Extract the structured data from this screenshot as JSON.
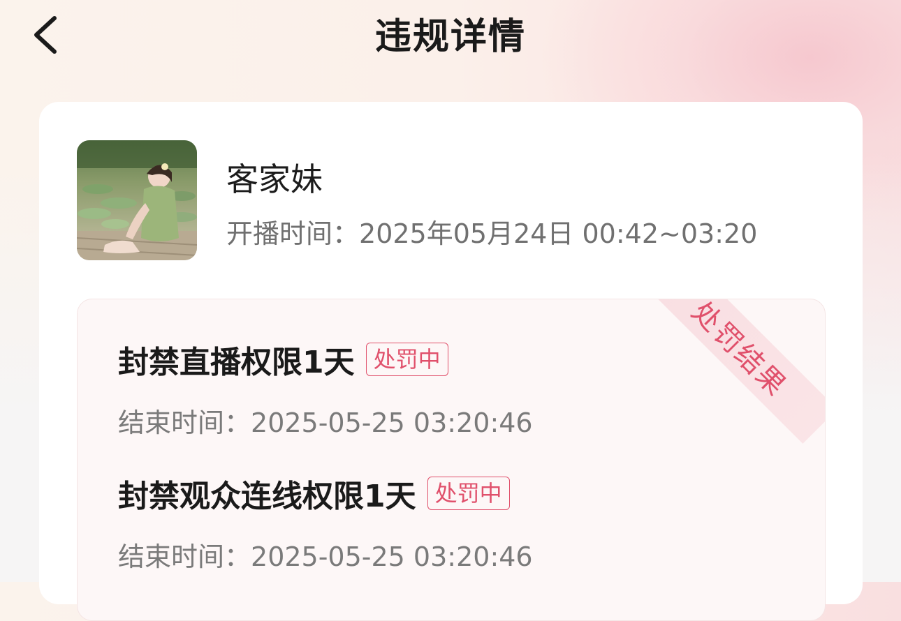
{
  "header": {
    "title": "违规详情",
    "back_icon": "chevron-left-icon"
  },
  "streamer": {
    "name": "客家妹",
    "live_time_label": "开播时间：",
    "live_time_value": "2025年05月24日 00:42~03:20"
  },
  "result": {
    "ribbon_label": "处罚结果",
    "penalties": [
      {
        "title": "封禁直播权限1天",
        "status": "处罚中",
        "end_label": "结束时间：",
        "end_value": "2025-05-25 03:20:46"
      },
      {
        "title": "封禁观众连线权限1天",
        "status": "处罚中",
        "end_label": "结束时间：",
        "end_value": "2025-05-25 03:20:46"
      }
    ]
  },
  "colors": {
    "accent": "#e0506b",
    "title_text": "#1a1a1a",
    "secondary_text": "#707070"
  }
}
